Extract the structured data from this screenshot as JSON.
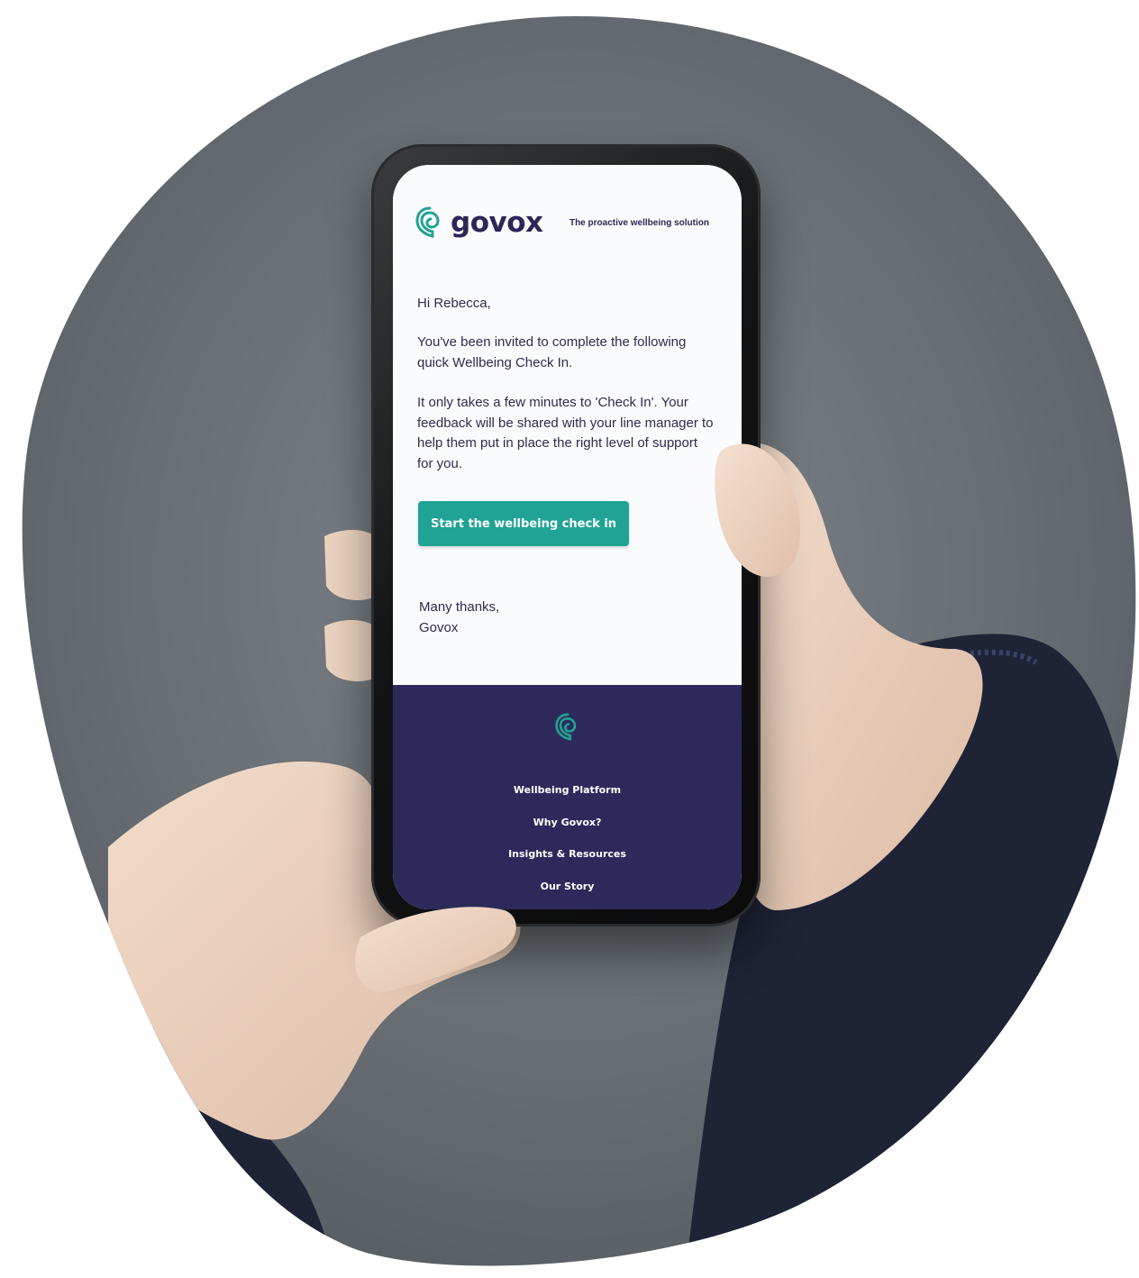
{
  "brand": {
    "name": "govox",
    "tagline": "The proactive wellbeing solution",
    "primary_color": "#2d295a",
    "accent_color": "#20a394"
  },
  "email": {
    "greeting": "Hi Rebecca,",
    "paragraph_1": "You've been invited to complete the following quick Wellbeing Check In.",
    "paragraph_2": "It only takes a few minutes to 'Check In'. Your feedback will be shared with your line manager to help them put in place the right level of support for you.",
    "cta_label": "Start the wellbeing check in",
    "signoff_line_1": "Many thanks,",
    "signoff_line_2": "Govox"
  },
  "footer": {
    "icon": "govox-mark-icon",
    "links": [
      "Wellbeing Platform",
      "Why Govox?",
      "Insights & Resources",
      "Our Story"
    ]
  },
  "scene": {
    "background_icon": "hands-holding-phone",
    "backdrop_color": "#6b7278",
    "sleeve_color": "#1e2336"
  }
}
